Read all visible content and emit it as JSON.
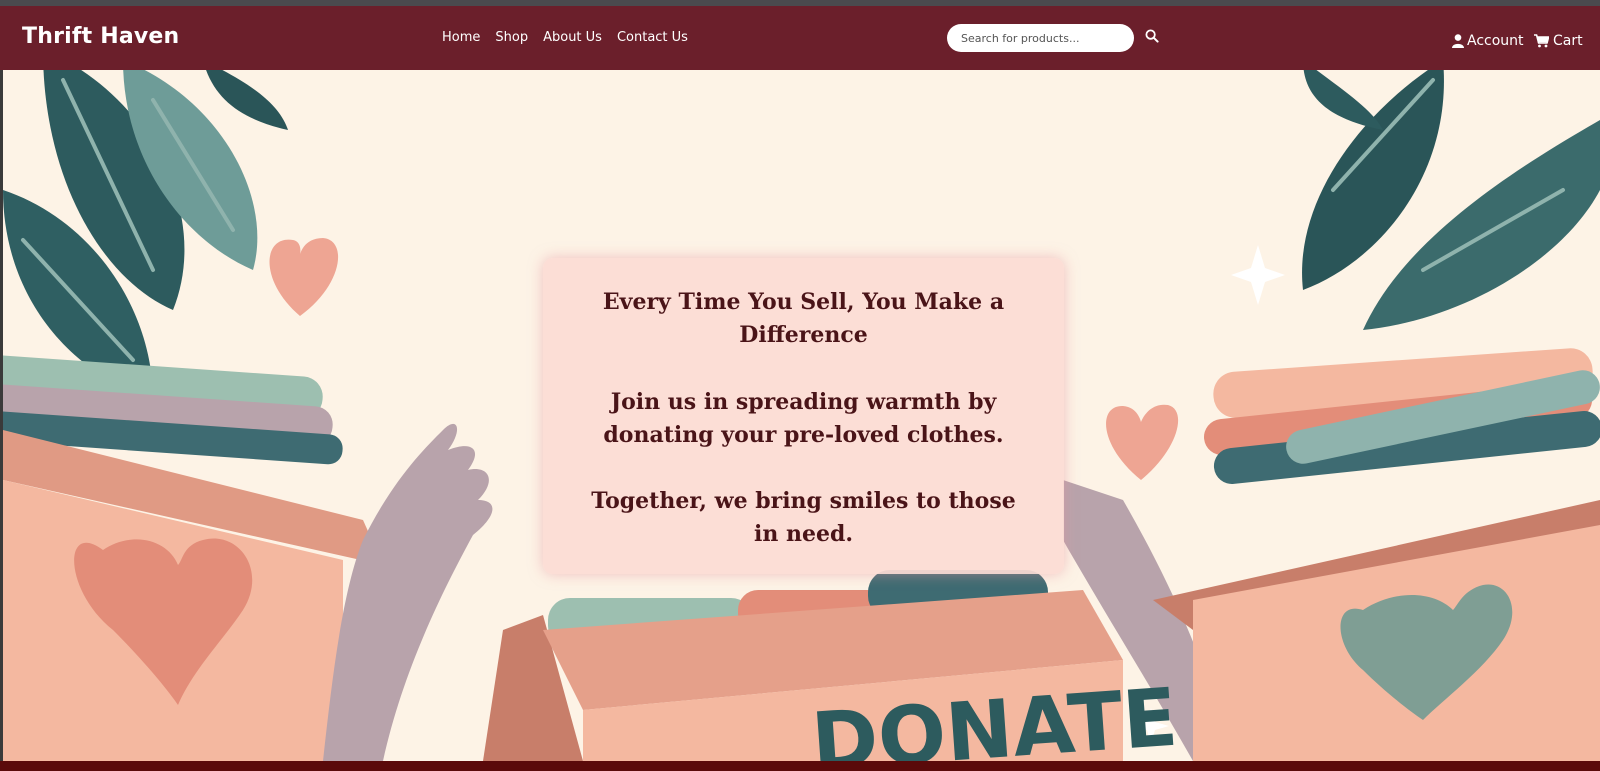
{
  "navbar": {
    "brand": "Thrift Haven",
    "links": [
      "Home",
      "Shop",
      "About Us",
      "Contact Us"
    ],
    "search": {
      "placeholder": "Search for products..."
    },
    "account_label": "Account",
    "cart_label": "Cart",
    "icons": {
      "search": "search-icon",
      "account": "user-icon",
      "cart": "cart-icon"
    }
  },
  "hero": {
    "heading": "Every Time You Sell, You Make a Difference",
    "line2": "Join us in spreading warmth by donating your pre-loved clothes.",
    "line3": "Together, we bring smiles to those in need.",
    "box_text": "DONATE"
  },
  "colors": {
    "navbar": "#6b1f2b",
    "hero_background": "#fdf3e6",
    "card": "#fcdcd4",
    "text": "#4a1418"
  }
}
